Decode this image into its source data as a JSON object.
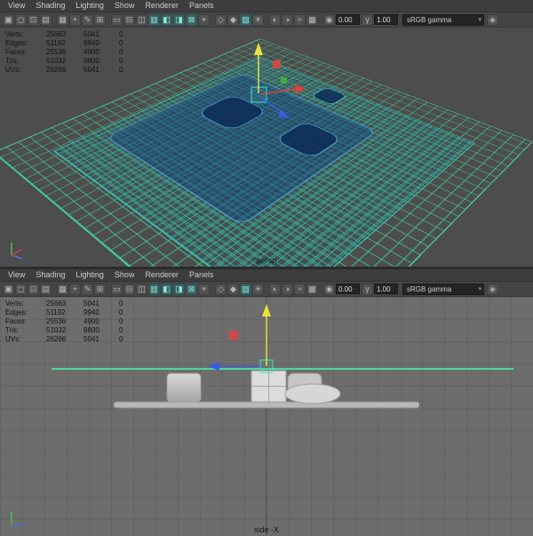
{
  "menu": {
    "items": [
      "View",
      "Shading",
      "Lighting",
      "Show",
      "Renderer",
      "Panels"
    ]
  },
  "toolbar": {
    "icons": [
      {
        "name": "select-camera",
        "glyph": "▣"
      },
      {
        "name": "camera-lock",
        "glyph": "◻"
      },
      {
        "name": "camera-attributes",
        "glyph": "⊡"
      },
      {
        "name": "bookmarks",
        "glyph": "▤"
      },
      {
        "name": "image-plane",
        "glyph": "▦"
      },
      {
        "name": "pan-zoom-2d",
        "glyph": "+"
      },
      {
        "name": "grease-pencil",
        "glyph": "✎"
      },
      {
        "name": "grid-toggle",
        "glyph": "⊞"
      },
      {
        "name": "film-gate",
        "glyph": "▭"
      },
      {
        "name": "resolution-gate",
        "glyph": "⊟"
      },
      {
        "name": "gate-mask",
        "glyph": "◫"
      },
      {
        "name": "field-chart",
        "glyph": "▥"
      },
      {
        "name": "safe-action",
        "glyph": "◧"
      },
      {
        "name": "safe-title",
        "glyph": "◨"
      },
      {
        "name": "frame-all",
        "glyph": "⊠"
      },
      {
        "name": "frame-selection",
        "glyph": "⌖"
      },
      {
        "name": "wireframe-mode",
        "glyph": "◇"
      },
      {
        "name": "shaded-mode",
        "glyph": "◆"
      },
      {
        "name": "textured-mode",
        "glyph": "▨"
      },
      {
        "name": "use-all-lights",
        "glyph": "☀"
      },
      {
        "name": "shadows",
        "glyph": "◐"
      },
      {
        "name": "ambient-occlusion",
        "glyph": "◑"
      },
      {
        "name": "motion-blur",
        "glyph": "≈"
      },
      {
        "name": "multisample-aa",
        "glyph": "▩"
      }
    ],
    "exposure_icon": "◉",
    "exposure_value": "0.00",
    "gamma_icon": "γ",
    "gamma_value": "1.00",
    "view_transform": "sRGB gamma",
    "dropdown_arrow": "▾",
    "color_management_icon": "◈"
  },
  "hud": {
    "rows": [
      {
        "label": "Verts:",
        "total": "25663",
        "selected": "5041",
        "other": "0"
      },
      {
        "label": "Edges:",
        "total": "51192",
        "selected": "9940",
        "other": "0"
      },
      {
        "label": "Faces:",
        "total": "25536",
        "selected": "4900",
        "other": "0"
      },
      {
        "label": "Tris:",
        "total": "51032",
        "selected": "9800",
        "other": "0"
      },
      {
        "label": "UVs:",
        "total": "26266",
        "selected": "5041",
        "other": "0"
      }
    ]
  },
  "panels": [
    {
      "camera_label": "persp"
    },
    {
      "camera_label": "side -X"
    }
  ],
  "colors": {
    "grid_green": "#3fd296",
    "selection_blue": "#4fa6e0",
    "manip_yellow": "#ece23e",
    "manip_red": "#de4040",
    "manip_blue": "#3b5be0",
    "handle_green": "#3fae3f",
    "active_icon_teal": "#8fe8d8"
  }
}
